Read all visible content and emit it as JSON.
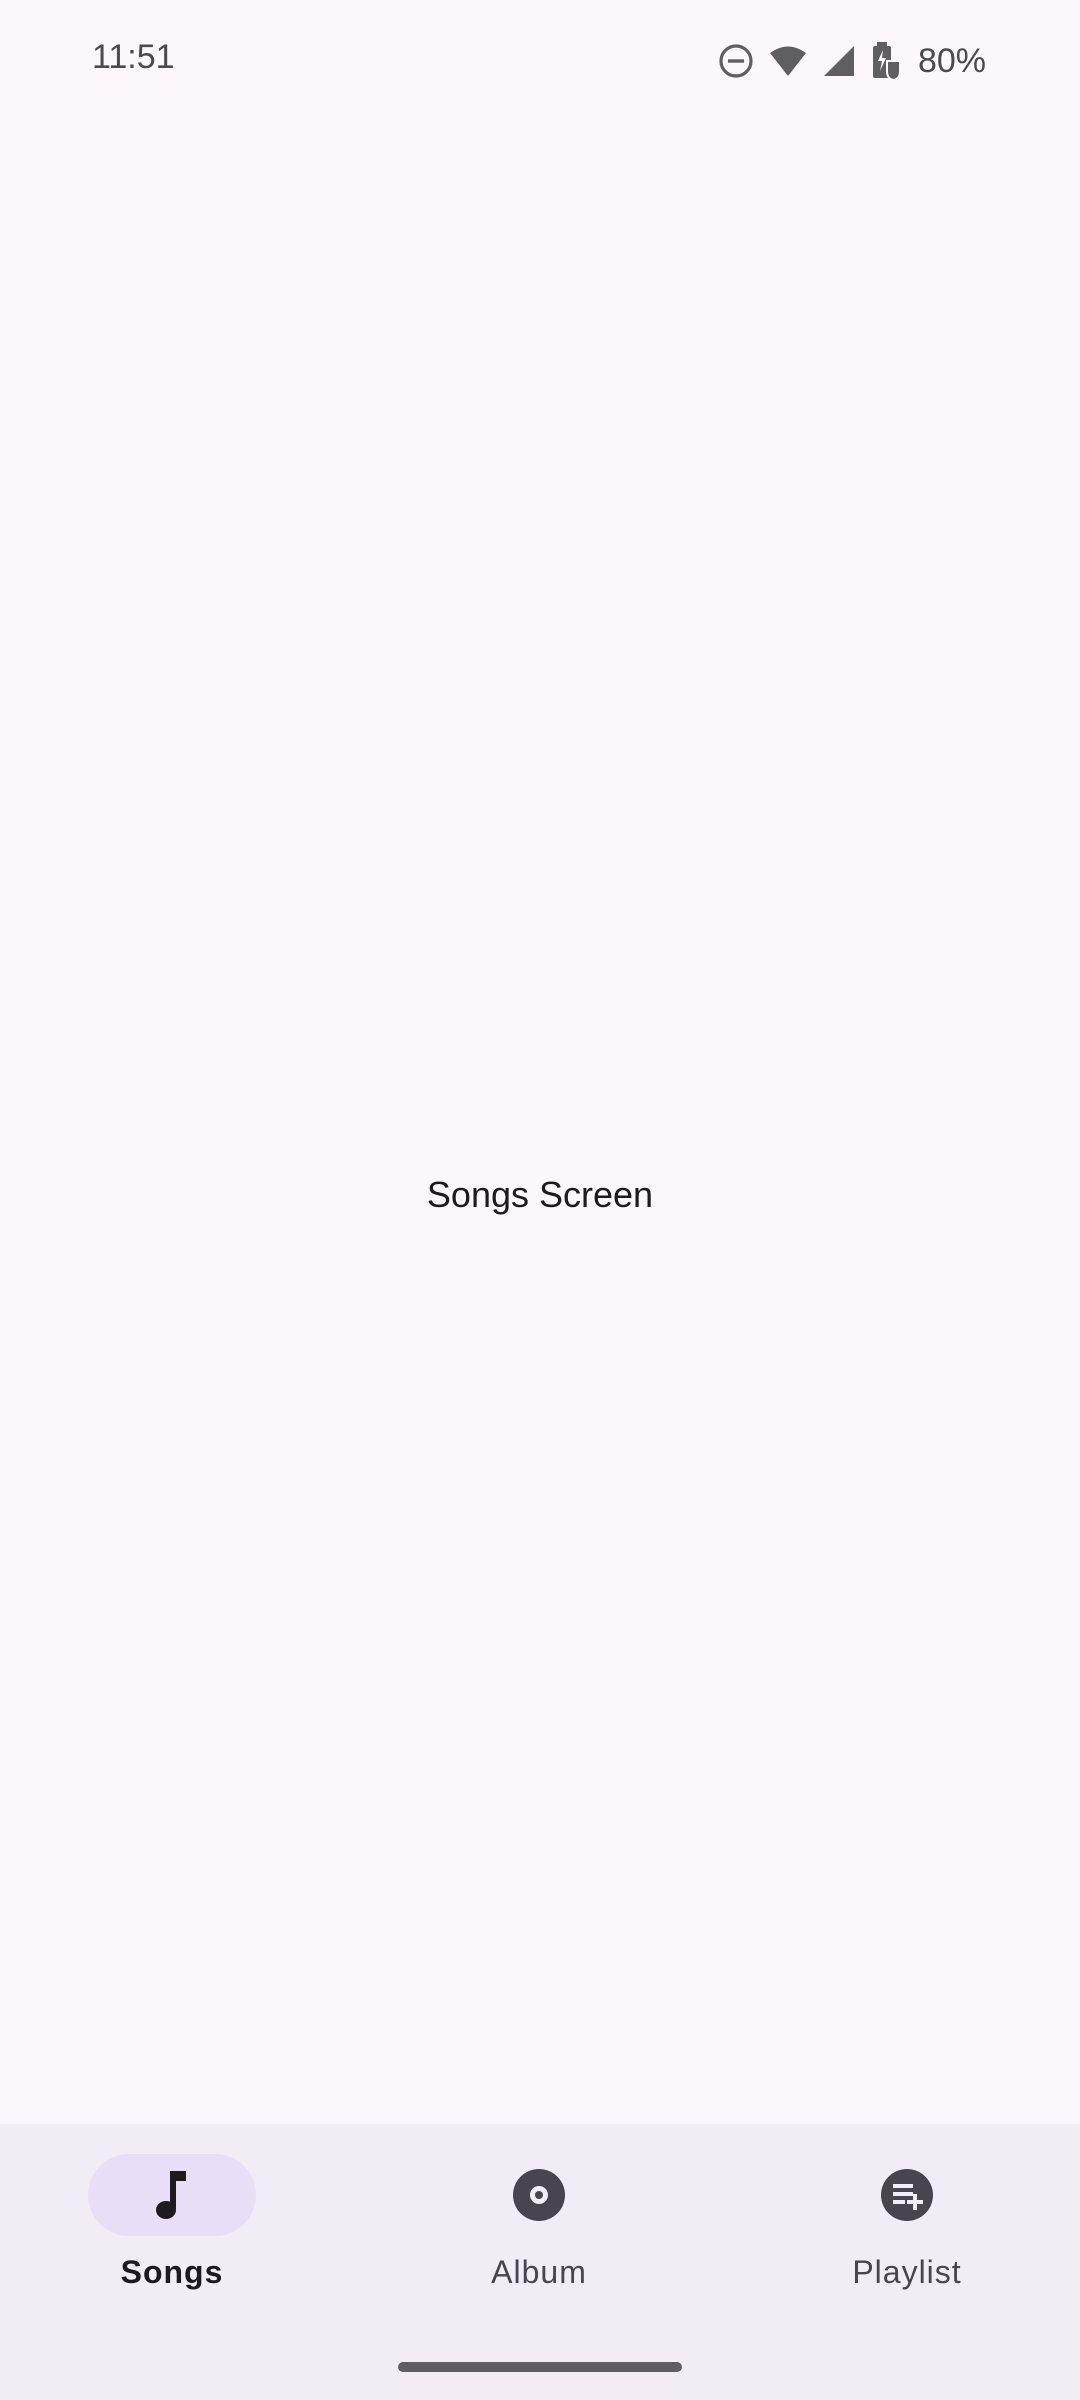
{
  "status_bar": {
    "time": "11:51",
    "battery": "80%",
    "icons": [
      "do-not-disturb-icon",
      "wifi-icon",
      "cell-signal-icon",
      "battery-charging-icon"
    ]
  },
  "main": {
    "screen_label": "Songs Screen"
  },
  "bottom_nav": {
    "items": [
      {
        "label": "Songs",
        "icon": "music-note-icon",
        "selected": true
      },
      {
        "label": "Album",
        "icon": "album-disc-icon",
        "selected": false
      },
      {
        "label": "Playlist",
        "icon": "playlist-add-icon",
        "selected": false
      }
    ]
  },
  "colors": {
    "background": "#FCF7FC",
    "nav_background": "#F2ECF4",
    "active_indicator": "#E8DEF8",
    "icon": "#49454F",
    "text_primary": "#1D1B20"
  }
}
